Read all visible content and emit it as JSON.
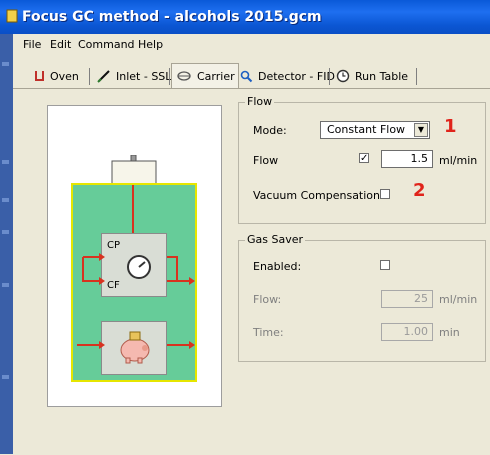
{
  "window": {
    "title": "Focus GC method - alcohols 2015.gcm"
  },
  "menu": [
    "File",
    "Edit",
    "Command",
    "Help"
  ],
  "tabs": [
    {
      "label": "Oven",
      "icon": "oven-icon"
    },
    {
      "label": "Inlet - SSL",
      "icon": "syringe-icon"
    },
    {
      "label": "Carrier",
      "icon": "carrier-icon",
      "active": true
    },
    {
      "label": "Detector - FID",
      "icon": "magnifier-icon"
    },
    {
      "label": "Run Table",
      "icon": "clock-icon"
    }
  ],
  "diagram": {
    "cp_label": "CP",
    "cf_label": "CF"
  },
  "flow_group": {
    "title": "Flow",
    "mode_label": "Mode:",
    "mode_value": "Constant Flow",
    "flow_label": "Flow",
    "flow_checked": true,
    "flow_value": "1.5",
    "flow_unit": "ml/min",
    "vacuum_label": "Vacuum Compensation:",
    "vacuum_checked": false
  },
  "gas_saver_group": {
    "title": "Gas Saver",
    "enabled_label": "Enabled:",
    "enabled_checked": false,
    "flow_label": "Flow:",
    "flow_value": "25",
    "flow_unit": "ml/min",
    "time_label": "Time:",
    "time_value": "1.00",
    "time_unit": "min"
  },
  "annotations": [
    "1",
    "2"
  ],
  "colors": {
    "title_bar": "#0a59d8",
    "annotation": "#e0241b",
    "diagram_green": "#66cc99",
    "diagram_border": "#e6e600"
  }
}
